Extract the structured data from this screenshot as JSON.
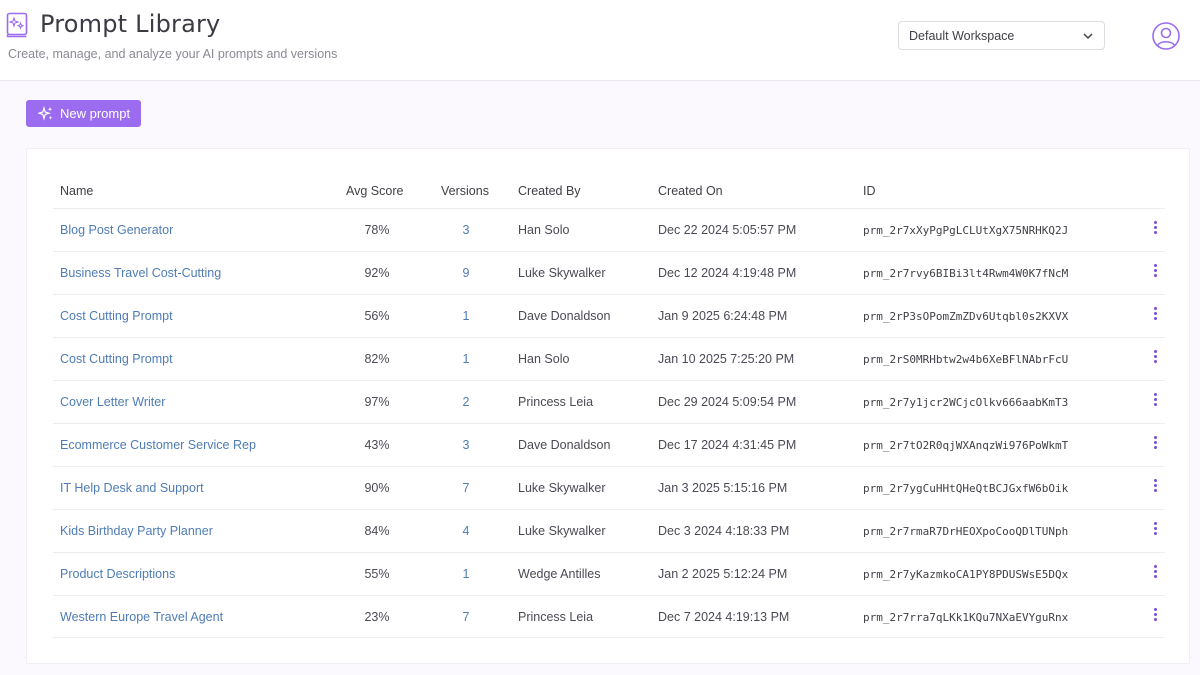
{
  "header": {
    "title": "Prompt Library",
    "subtitle": "Create, manage, and analyze your AI prompts and versions",
    "workspace": "Default Workspace",
    "logo_icon": "prompt-library-icon",
    "avatar_icon": "user-circle-icon"
  },
  "toolbar": {
    "new_prompt_label": "New prompt",
    "new_prompt_icon": "sparkle-icon",
    "accent_color": "#9b6cf0"
  },
  "table": {
    "columns": [
      "Name",
      "Avg Score",
      "Versions",
      "Created By",
      "Created On",
      "ID"
    ],
    "rows": [
      {
        "name": "Blog Post Generator",
        "score": "78%",
        "versions": "3",
        "created_by": "Han Solo",
        "created_on": "Dec 22 2024 5:05:57 PM",
        "id": "prm_2r7xXyPgPgLCLUtXgX75NRHKQ2J"
      },
      {
        "name": "Business Travel Cost-Cutting",
        "score": "92%",
        "versions": "9",
        "created_by": "Luke Skywalker",
        "created_on": "Dec 12 2024 4:19:48 PM",
        "id": "prm_2r7rvy6BIBi3lt4Rwm4W0K7fNcM"
      },
      {
        "name": "Cost Cutting Prompt",
        "score": "56%",
        "versions": "1",
        "created_by": "Dave Donaldson",
        "created_on": "Jan 9 2025 6:24:48 PM",
        "id": "prm_2rP3sOPomZmZDv6Utqbl0s2KXVX"
      },
      {
        "name": "Cost Cutting Prompt",
        "score": "82%",
        "versions": "1",
        "created_by": "Han Solo",
        "created_on": "Jan 10 2025 7:25:20 PM",
        "id": "prm_2rS0MRHbtw2w4b6XeBFlNAbrFcU"
      },
      {
        "name": "Cover Letter Writer",
        "score": "97%",
        "versions": "2",
        "created_by": "Princess Leia",
        "created_on": "Dec 29 2024 5:09:54 PM",
        "id": "prm_2r7y1jcr2WCjcOlkv666aabKmT3"
      },
      {
        "name": "Ecommerce Customer Service Rep",
        "score": "43%",
        "versions": "3",
        "created_by": "Dave Donaldson",
        "created_on": "Dec 17 2024 4:31:45 PM",
        "id": "prm_2r7tO2R0qjWXAnqzWi976PoWkmT"
      },
      {
        "name": "IT Help Desk and Support",
        "score": "90%",
        "versions": "7",
        "created_by": "Luke Skywalker",
        "created_on": "Jan 3 2025 5:15:16 PM",
        "id": "prm_2r7ygCuHHtQHeQtBCJGxfW6bOik"
      },
      {
        "name": "Kids Birthday Party Planner",
        "score": "84%",
        "versions": "4",
        "created_by": "Luke Skywalker",
        "created_on": "Dec 3 2024 4:18:33 PM",
        "id": "prm_2r7rmaR7DrHEOXpoCooQDlTUNph"
      },
      {
        "name": "Product Descriptions",
        "score": "55%",
        "versions": "1",
        "created_by": "Wedge Antilles",
        "created_on": "Jan 2 2025 5:12:24 PM",
        "id": "prm_2r7yKazmkoCA1PY8PDUSWsE5DQx"
      },
      {
        "name": "Western Europe Travel Agent",
        "score": "23%",
        "versions": "7",
        "created_by": "Princess Leia",
        "created_on": "Dec 7 2024 4:19:13 PM",
        "id": "prm_2r7rra7qLKk1KQu7NXaEVYguRnx"
      }
    ],
    "row_menu_icon": "more-vertical-icon"
  }
}
